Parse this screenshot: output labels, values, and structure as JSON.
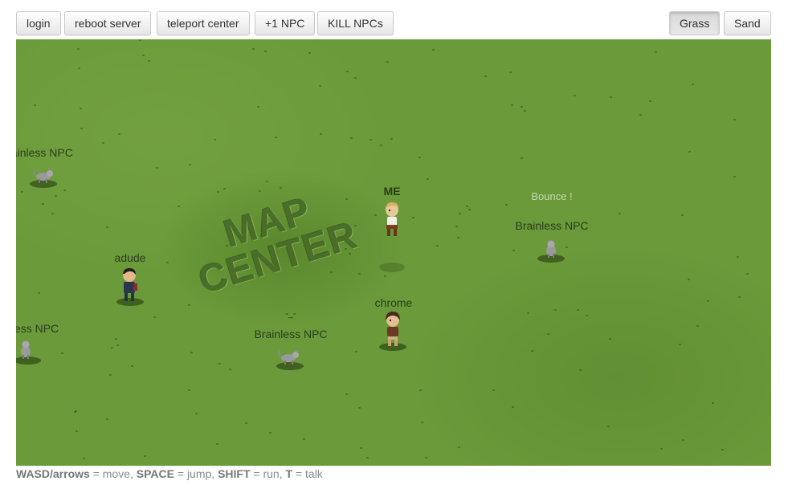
{
  "toolbar": {
    "left_buttons": [
      "login",
      "reboot server",
      "teleport center",
      "+1 NPC",
      "KILL NPCs"
    ],
    "right_buttons": [
      "Grass",
      "Sand"
    ],
    "active_terrain": "Grass"
  },
  "map": {
    "terrain": "grass",
    "center_text_line1": "MAP",
    "center_text_line2": "CENTER",
    "entities": {
      "npc_left_top": "rainless NPC",
      "player_me": "ME",
      "bounce_bubble": "Bounce !",
      "npc_right": "Brainless NPC",
      "player_adude": "adude",
      "npc_left_bottom": "less NPC",
      "chat_small": "-_-",
      "npc_center_bottom": "Brainless NPC",
      "player_chrome": "chrome"
    }
  },
  "footer": {
    "k1": "WASD/arrows",
    "t1": " = move, ",
    "k2": "SPACE",
    "t2": " = jump, ",
    "k3": "SHIFT",
    "t3": " = run, ",
    "k4": "T",
    "t4": " = talk"
  },
  "colors": {
    "grass": "#6a9a3a",
    "label": "#2e3d1c"
  }
}
